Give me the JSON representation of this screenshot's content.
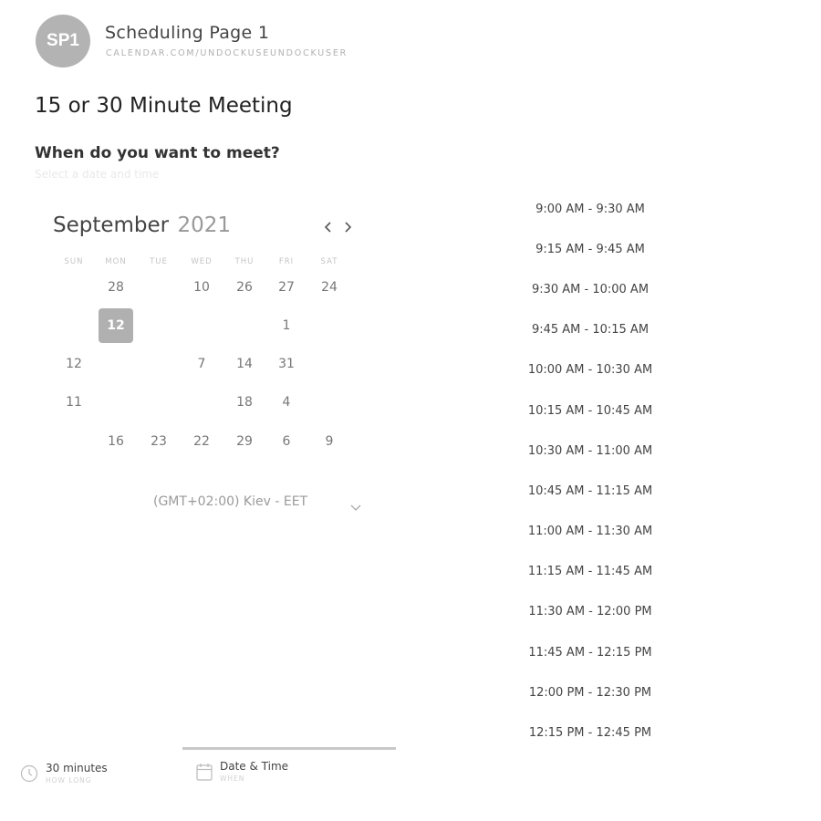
{
  "header": {
    "avatar_initials": "SP1",
    "page_name": "Scheduling Page 1",
    "url": "CALENDAR.COM/UNDOCKUSEUNDOCKUSER"
  },
  "meeting": {
    "title": "15 or 30 Minute Meeting",
    "question": "When do you want to meet?",
    "subtext": "Select a date and time"
  },
  "calendar": {
    "month": "September",
    "year": "2021",
    "weekdays": [
      "SUN",
      "MON",
      "TUE",
      "WED",
      "THU",
      "FRI",
      "SAT"
    ],
    "days": [
      [
        "",
        "28",
        "",
        "10",
        "26",
        "27",
        "24"
      ],
      [
        "",
        "12",
        "",
        "",
        "",
        "1",
        ""
      ],
      [
        "12",
        "",
        "",
        "7",
        "14",
        "31",
        ""
      ],
      [
        "11",
        "",
        "",
        "",
        "18",
        "4",
        ""
      ],
      [
        "",
        "16",
        "23",
        "22",
        "29",
        "6",
        "9"
      ]
    ],
    "selected": {
      "row": 1,
      "col": 1
    },
    "timezone": "(GMT+02:00) Kiev - EET"
  },
  "slots": [
    "9:00 AM - 9:30 AM",
    "9:15 AM - 9:45 AM",
    "9:30 AM - 10:00 AM",
    "9:45 AM - 10:15 AM",
    "10:00 AM - 10:30 AM",
    "10:15 AM - 10:45 AM",
    "10:30 AM - 11:00 AM",
    "10:45 AM - 11:15 AM",
    "11:00 AM - 11:30 AM",
    "11:15 AM - 11:45 AM",
    "11:30 AM - 12:00 PM",
    "11:45 AM - 12:15 PM",
    "12:00 PM - 12:30 PM",
    "12:15 PM - 12:45 PM"
  ],
  "steps": {
    "duration": {
      "label": "30 minutes",
      "sub": "HOW LONG",
      "icon": "clock-icon"
    },
    "datetime": {
      "label": "Date & Time",
      "sub": "WHEN",
      "icon": "calendar-icon"
    }
  },
  "colors": {
    "selected_day": "#b0b0b0",
    "step_indicator": "#c8c8c8"
  }
}
